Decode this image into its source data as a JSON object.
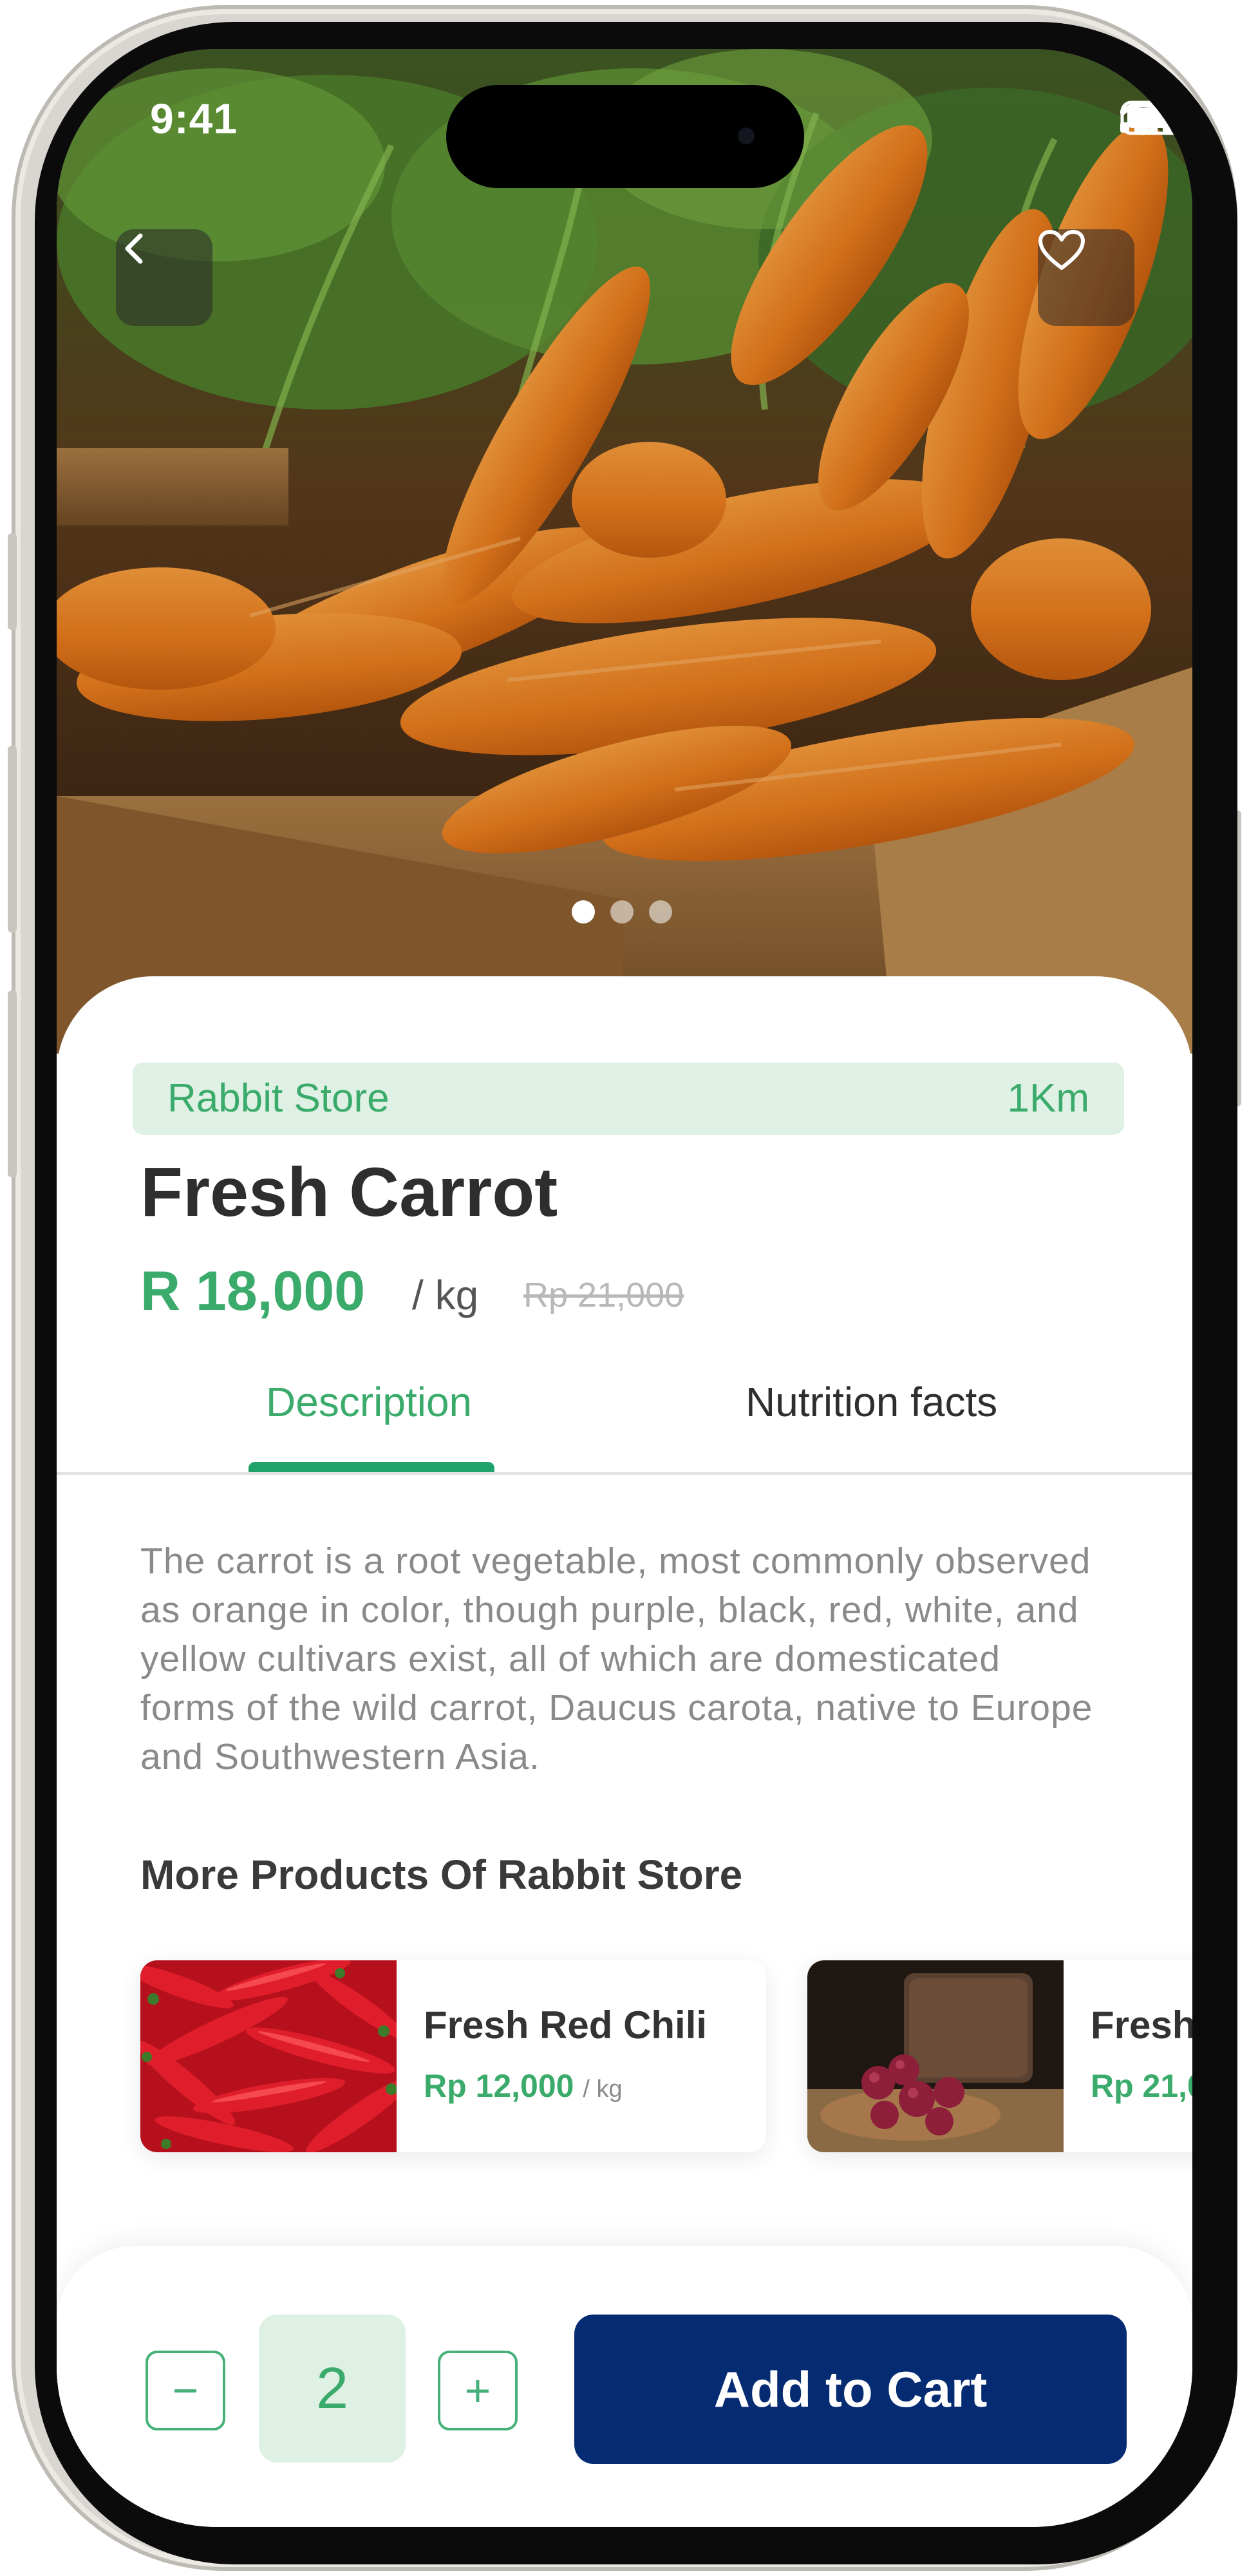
{
  "status_bar": {
    "time": "9:41"
  },
  "hero": {
    "image_alt": "Fresh carrots in wooden crate",
    "dots_count": 3,
    "active_dot": 0
  },
  "store": {
    "name": "Rabbit Store",
    "distance": "1Km"
  },
  "product": {
    "title": "Fresh Carrot",
    "price": "R 18,000",
    "unit": "/ kg",
    "old_price": "Rp 21,000"
  },
  "tabs": {
    "description": "Description",
    "nutrition": "Nutrition facts"
  },
  "description": "The carrot is a root vegetable, most commonly observed as orange in color, though purple, black, red, white, and yellow cultivars exist, all of which are domesticated forms of the wild carrot, Daucus carota, native to Europe and Southwestern Asia.",
  "more_products": {
    "title": "More Products  Of Rabbit Store",
    "items": [
      {
        "name": "Fresh Red Chili",
        "price": "Rp 12,000",
        "unit": "/ kg"
      },
      {
        "name": "Fresh",
        "price": "Rp 21,0",
        "unit": ""
      }
    ]
  },
  "cart": {
    "minus": "−",
    "quantity": "2",
    "plus": "+",
    "add_label": "Add to Cart"
  },
  "colors": {
    "accent_green": "#3bab6b",
    "primary_navy": "#052b73",
    "light_green": "#dff0e4"
  },
  "icons": {
    "back": "chevron-left-icon",
    "favorite": "heart-icon"
  }
}
